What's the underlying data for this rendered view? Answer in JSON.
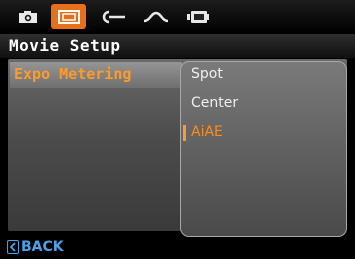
{
  "tabbar": {
    "tabs": [
      {
        "icon": "camera-icon",
        "active": false
      },
      {
        "icon": "movie-icon",
        "active": true
      },
      {
        "icon": "key-icon",
        "active": false
      },
      {
        "icon": "wave-icon",
        "active": false
      },
      {
        "icon": "battery-connect-icon",
        "active": false
      }
    ],
    "accent_color": "#e8701a"
  },
  "header": {
    "title": "Movie Setup"
  },
  "menu": {
    "items": [
      {
        "label": "Expo Metering",
        "selected": true
      }
    ]
  },
  "submenu": {
    "options": [
      {
        "label": "Spot",
        "selected": false
      },
      {
        "label": "Center",
        "selected": false
      },
      {
        "label": "AiAE",
        "selected": true
      }
    ]
  },
  "footer": {
    "back_label": "BACK",
    "back_icon": "left-arrow-icon",
    "color": "#4aa3e8"
  }
}
